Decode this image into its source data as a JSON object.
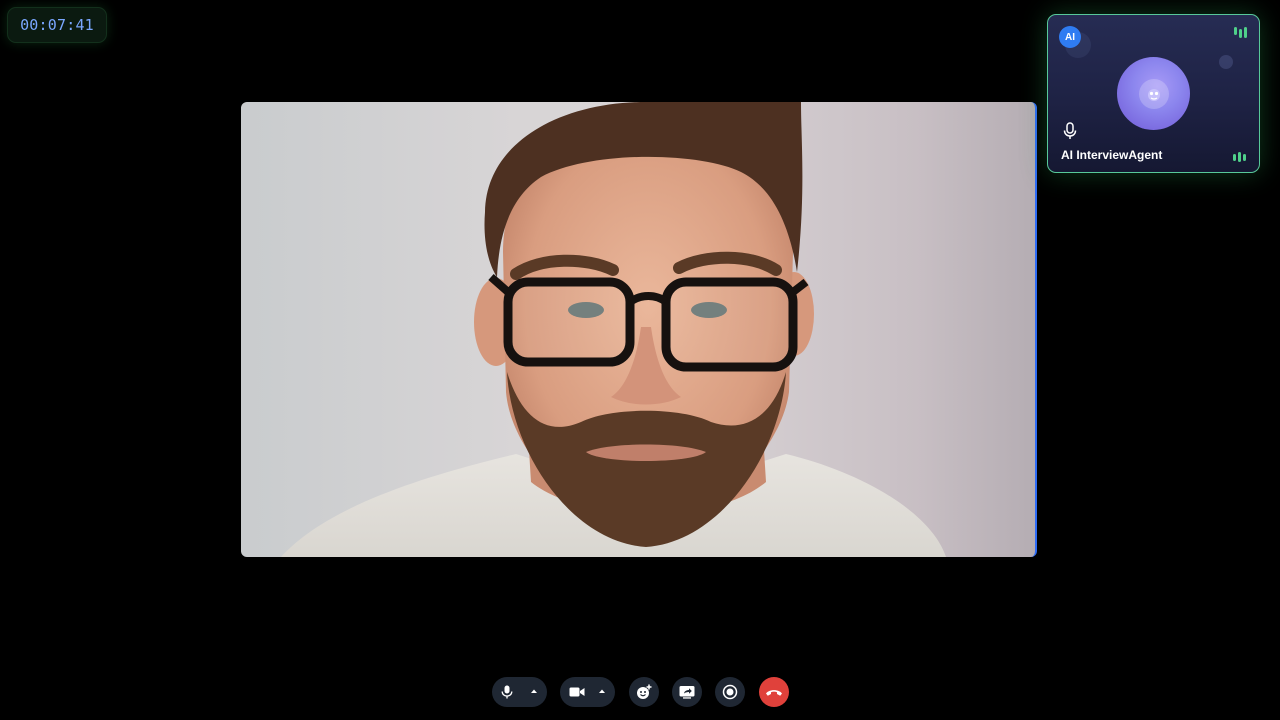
{
  "call": {
    "timer": "00:07:41"
  },
  "main_video": {
    "border_accent": "#2e6cf6"
  },
  "ai_tile": {
    "badge": "AI",
    "name": "AI InterviewAgent",
    "border_color": "#58c99a",
    "avatar_color": "#8c86ee",
    "speaking_indicator_color": "#4fd08a"
  },
  "controls": {
    "buttons": [
      {
        "id": "mic",
        "icon": "microphone-icon",
        "has_menu": true
      },
      {
        "id": "camera",
        "icon": "video-camera-icon",
        "has_menu": true
      },
      {
        "id": "reactions",
        "icon": "emoji-add-icon",
        "has_menu": false
      },
      {
        "id": "share",
        "icon": "screen-share-icon",
        "has_menu": false
      },
      {
        "id": "record",
        "icon": "record-icon",
        "has_menu": false
      },
      {
        "id": "leave",
        "icon": "phone-hangup-icon",
        "has_menu": false,
        "color": "#e0413b"
      }
    ]
  }
}
